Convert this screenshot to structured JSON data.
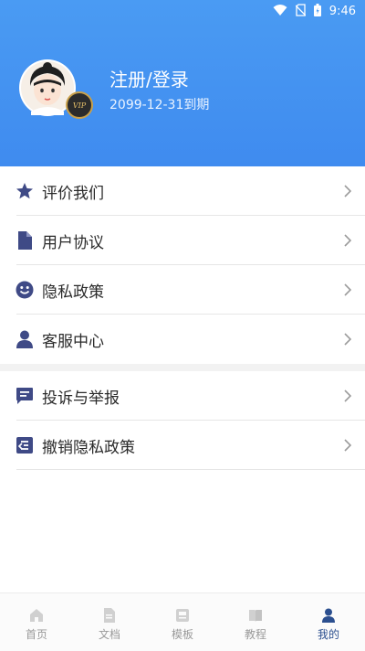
{
  "status_bar": {
    "time": "9:46",
    "icons": [
      "wifi-icon",
      "no-sim-icon",
      "battery-icon"
    ]
  },
  "profile": {
    "title": "注册/登录",
    "subtitle": "2099-12-31到期",
    "badge": "VIP"
  },
  "menu": {
    "group1": [
      {
        "label": "评价我们",
        "icon": "star-icon"
      },
      {
        "label": "用户协议",
        "icon": "document-icon"
      },
      {
        "label": "隐私政策",
        "icon": "smiley-icon"
      },
      {
        "label": "客服中心",
        "icon": "person-icon"
      }
    ],
    "group2": [
      {
        "label": "投诉与举报",
        "icon": "message-icon"
      },
      {
        "label": "撤销隐私政策",
        "icon": "revoke-icon"
      }
    ]
  },
  "tabs": [
    {
      "label": "首页",
      "icon": "home-icon",
      "active": false
    },
    {
      "label": "文档",
      "icon": "file-icon",
      "active": false
    },
    {
      "label": "模板",
      "icon": "template-icon",
      "active": false
    },
    {
      "label": "教程",
      "icon": "book-icon",
      "active": false
    },
    {
      "label": "我的",
      "icon": "user-icon",
      "active": true
    }
  ],
  "colors": {
    "header": "#4a9bf3",
    "menu_icon": "#3f4a86",
    "active_tab": "#2b4f8f",
    "inactive_tab": "#9a9a9a"
  }
}
